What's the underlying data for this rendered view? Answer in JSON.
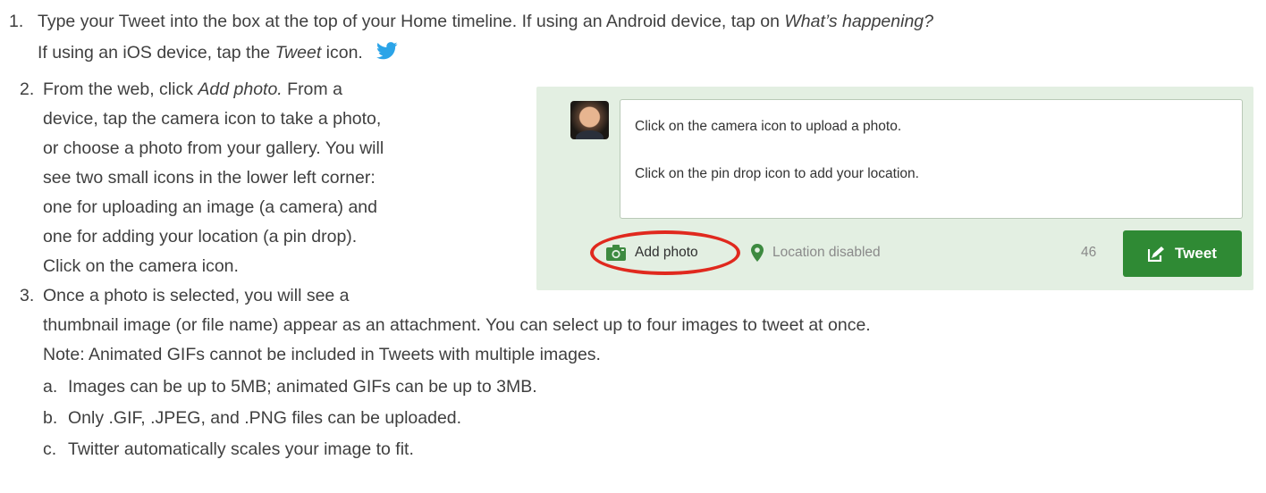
{
  "steps": {
    "s1": {
      "number": "1.",
      "line1_text": "Type your Tweet into the box at the top of your Home timeline. If using an Android device, tap on ",
      "line1_em": "What’s happening?",
      "line2_text": "If using an iOS device, tap the ",
      "line2_em": "Tweet",
      "line2_after": " icon."
    },
    "s2": {
      "number": "2.",
      "line1_text": "From the web, click ",
      "line1_em": "Add photo.",
      "line1_after": " From a",
      "lines": [
        "device, tap the camera icon to take a photo,",
        "or choose a photo from your gallery. You will",
        "see two small icons in the lower left corner:",
        "one for uploading an image (a camera) and",
        "one for adding your location (a pin drop).",
        "Click on the camera icon."
      ]
    },
    "s3": {
      "number": "3.",
      "lines": [
        "Once a photo is selected, you will see a",
        "thumbnail image (or file name) appear as an attachment. You can select up to four images to tweet at once.",
        "Note: Animated GIFs cannot be included in Tweets with multiple images."
      ],
      "sub": [
        {
          "letter": "a.",
          "text": "Images can be up to 5MB; animated GIFs can be up to 3MB."
        },
        {
          "letter": "b.",
          "text": "Only .GIF, .JPEG, and .PNG files can be uploaded."
        },
        {
          "letter": "c.",
          "text": "Twitter automatically scales your image to fit."
        }
      ]
    }
  },
  "composer": {
    "textbox_line1": "Click on the camera icon to upload a photo.",
    "textbox_line2": "Click on the pin drop icon to add your location.",
    "add_photo_label": "Add photo",
    "location_label": "Location disabled",
    "char_count": "46",
    "tweet_label": "Tweet",
    "icons": {
      "bird": "twitter-bird-icon",
      "camera": "camera-icon",
      "pin": "location-pin-icon",
      "compose": "compose-icon"
    }
  },
  "colors": {
    "text": "#3f3f3f",
    "twitter_blue": "#2ba4e8",
    "composer_bg": "#e3efe2",
    "tweet_button": "#2f8a34",
    "icon_green": "#3d8a40",
    "highlight_ring": "#e0291e"
  }
}
